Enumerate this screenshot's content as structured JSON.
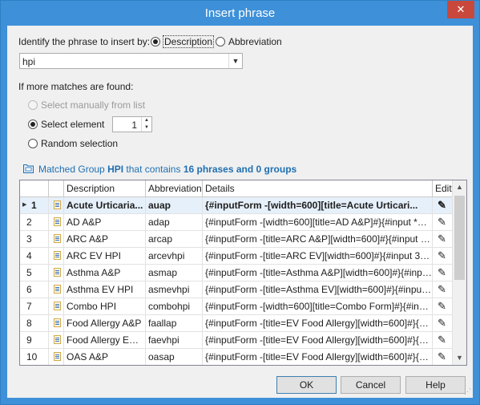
{
  "window": {
    "title": "Insert phrase",
    "close_glyph": "✕"
  },
  "identify": {
    "label": "Identify the phrase to insert by:",
    "options": [
      {
        "label": "Description",
        "selected": true
      },
      {
        "label": "Abbreviation",
        "selected": false
      }
    ]
  },
  "search": {
    "value": "hpi"
  },
  "matches": {
    "label": "If more matches are found:",
    "manual_label": "Select manually from list",
    "element_label": "Select element",
    "element_value": "1",
    "random_label": "Random selection"
  },
  "group": {
    "prefix": "Matched Group",
    "name": "HPI",
    "middle": "that contains",
    "counts": "16 phrases and 0 groups"
  },
  "table": {
    "columns": {
      "description": "Description",
      "abbreviation": "Abbreviation",
      "details": "Details",
      "edit": "Edit"
    },
    "rows": [
      {
        "n": "1",
        "description": "Acute Urticaria...",
        "abbreviation": "auap",
        "details": "{#inputForm -[width=600][title=Acute Urticari...",
        "selected": true
      },
      {
        "n": "2",
        "description": "AD A&P",
        "abbreviation": "adap",
        "details": "{#inputForm -[width=600][title=AD A&P]#}{#input *Mil..."
      },
      {
        "n": "3",
        "description": "ARC A&P",
        "abbreviation": "arcap",
        "details": "{#inputForm -[title=ARC A&P][width=600]#}{#input Mi..."
      },
      {
        "n": "4",
        "description": "ARC EV HPI",
        "abbreviation": "arcevhpi",
        "details": "{#inputForm -[title=ARC EV][width=600]#}{#input 3 m..."
      },
      {
        "n": "5",
        "description": "Asthma A&P",
        "abbreviation": "asmap",
        "details": "{#inputForm -[title=Asthma A&P][width=600]#}{#inpu..."
      },
      {
        "n": "6",
        "description": "Asthma EV HPI",
        "abbreviation": "asmevhpi",
        "details": "{#inputForm -[title=Asthma EV][width=600]#}{#input ..."
      },
      {
        "n": "7",
        "description": "Combo HPI",
        "abbreviation": "combohpi",
        "details": "{#inputForm -[width=600][title=Combo Form]#}{#inpu..."
      },
      {
        "n": "8",
        "description": "Food Allergy A&P",
        "abbreviation": "faallap",
        "details": "{#inputForm -[title=EV Food Allergy][width=600]#}{#i..."
      },
      {
        "n": "9",
        "description": "Food Allergy EV HPI",
        "abbreviation": "faevhpi",
        "details": "{#inputForm -[title=EV Food Allergy][width=600]#}{#i..."
      },
      {
        "n": "10",
        "description": "OAS A&P",
        "abbreviation": "oasap",
        "details": "{#inputForm -[title=EV Food Allergy][width=600]#}{#i..."
      }
    ]
  },
  "buttons": {
    "ok": "OK",
    "cancel": "Cancel",
    "help": "Help"
  },
  "colors": {
    "titlebar": "#3e90d8",
    "close": "#c9483c",
    "accent": "#1f6fb2"
  }
}
